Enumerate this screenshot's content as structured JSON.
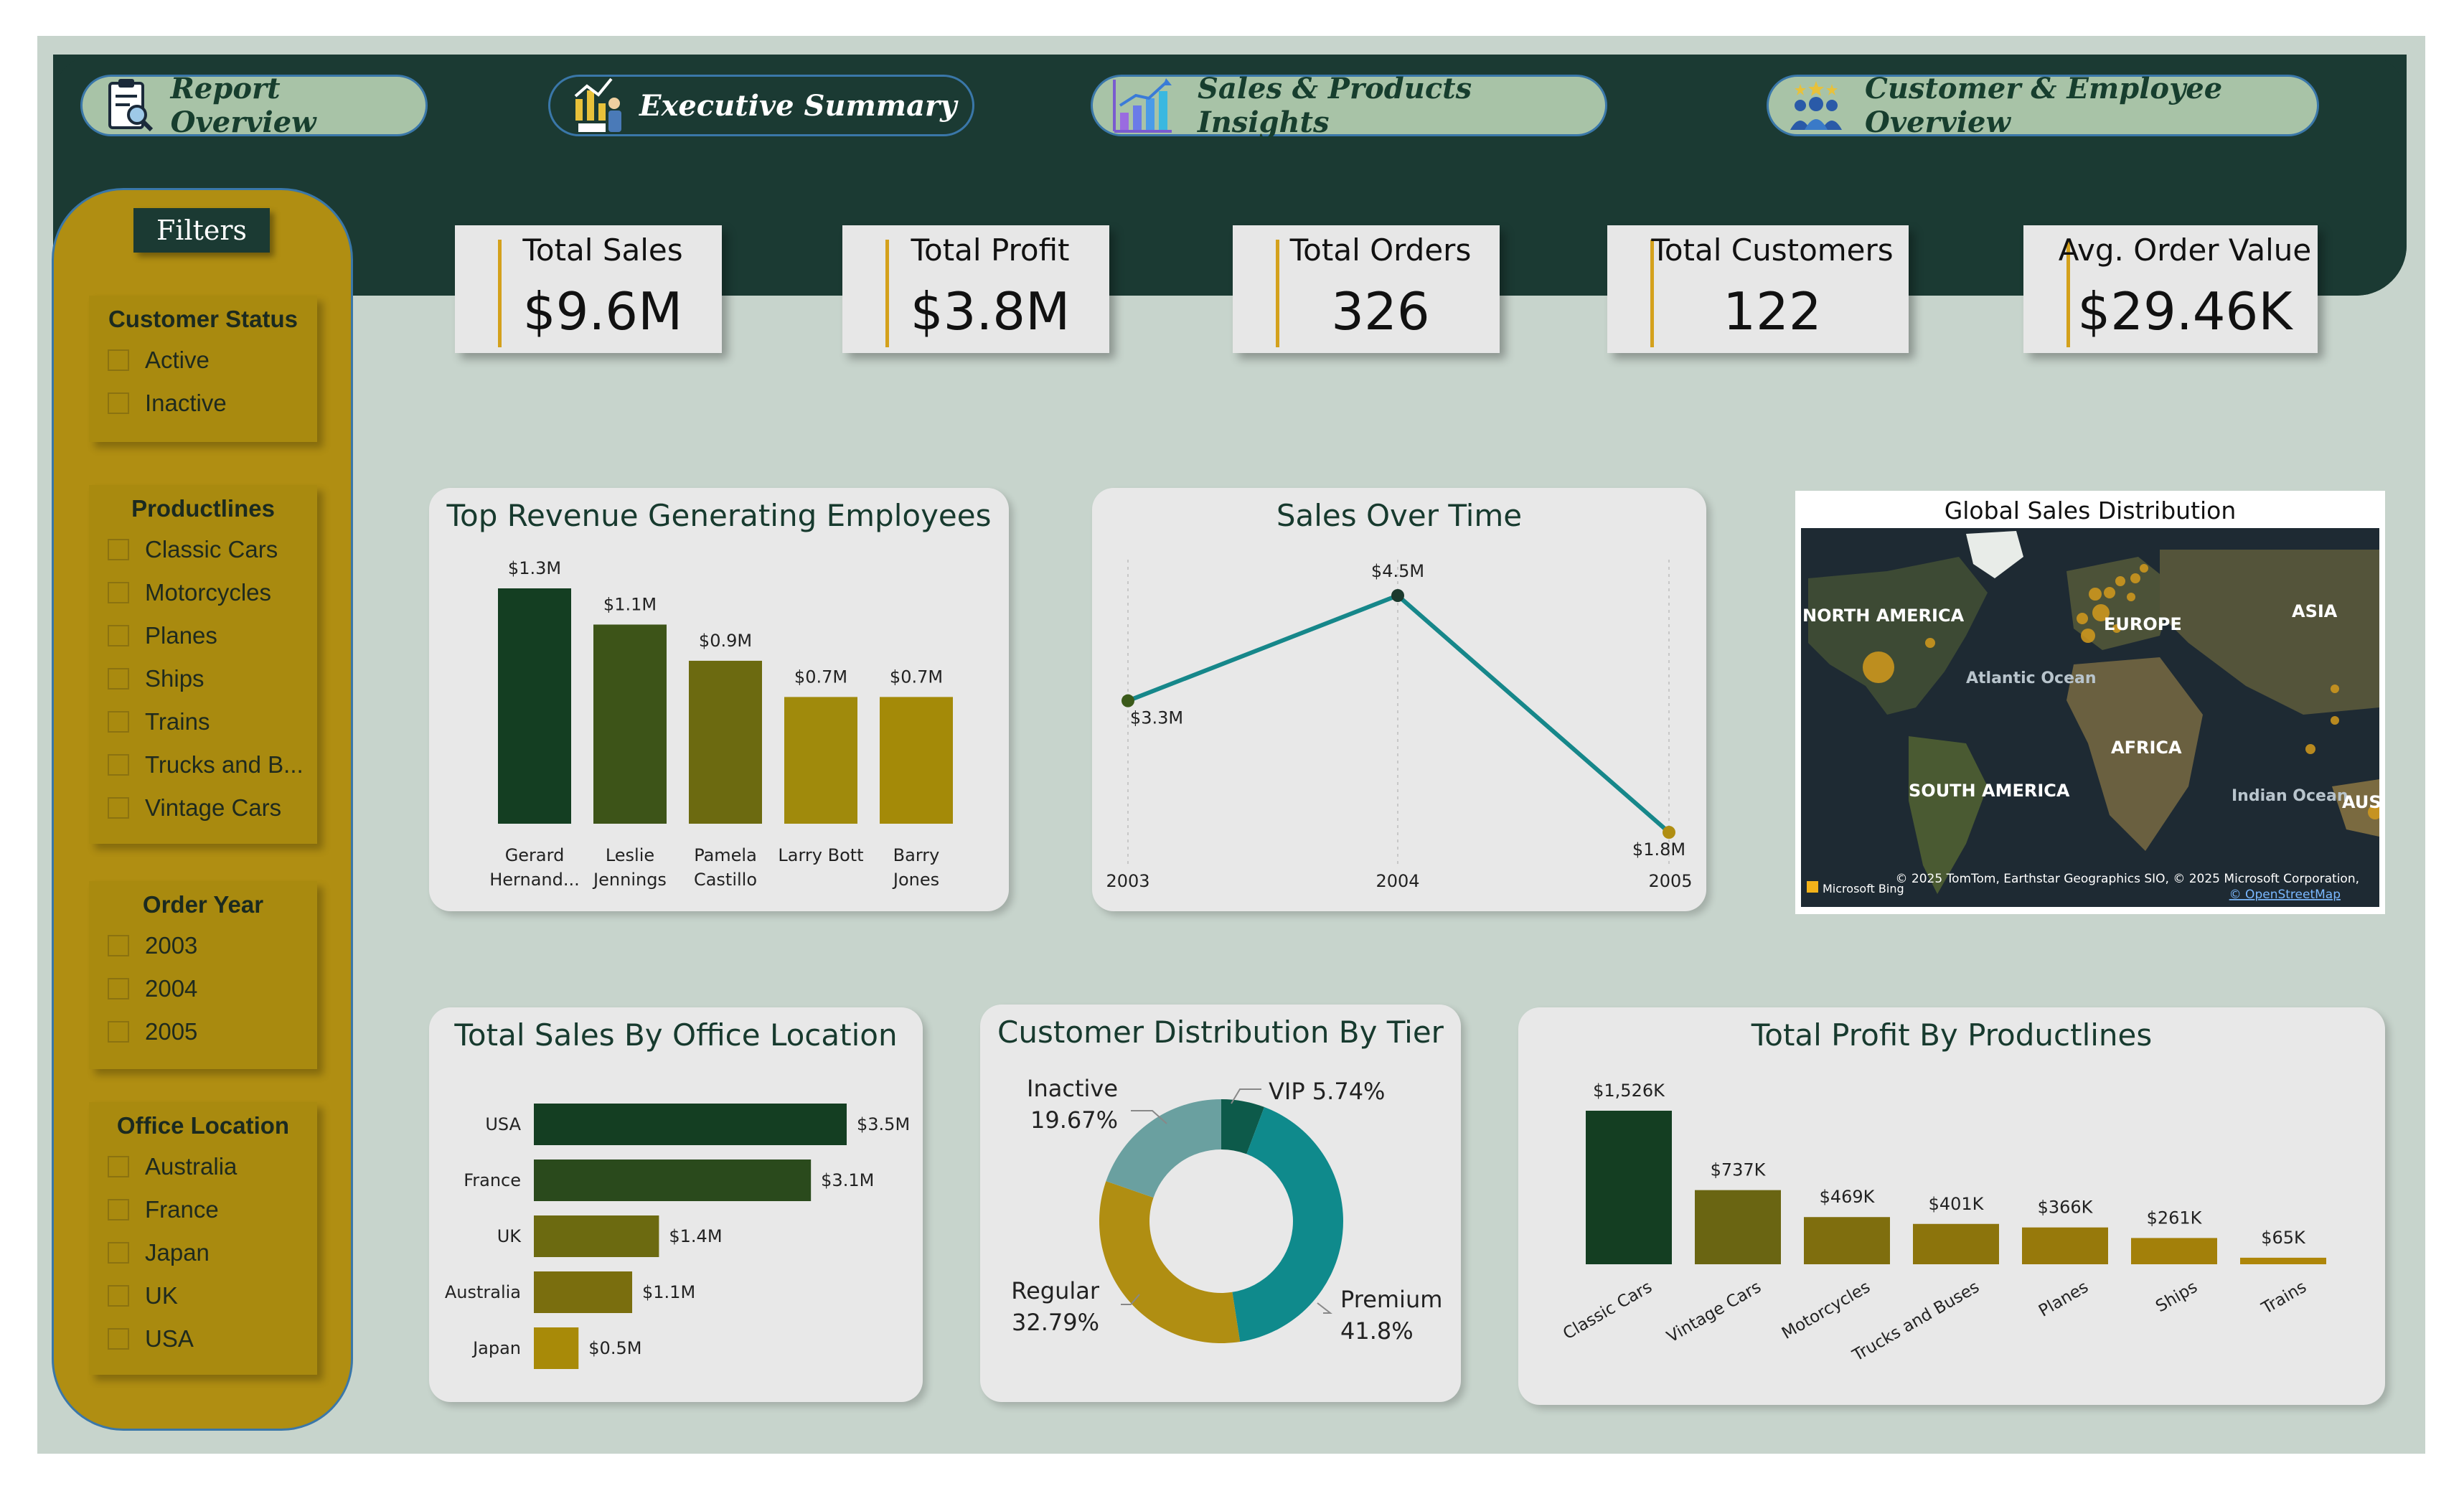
{
  "nav": [
    {
      "label": "Report Overview",
      "icon": "clipboard-search-icon"
    },
    {
      "label": "Executive Summary",
      "icon": "presentation-chart-icon"
    },
    {
      "label": "Sales & Products Insights",
      "icon": "bar-chart-icon"
    },
    {
      "label": "Customer & Employee Overview",
      "icon": "people-group-icon"
    }
  ],
  "filters": {
    "title": "Filters",
    "customer_status": {
      "title": "Customer Status",
      "options": [
        "Active",
        "Inactive"
      ]
    },
    "productlines": {
      "title": "Productlines",
      "options": [
        "Classic Cars",
        "Motorcycles",
        "Planes",
        "Ships",
        "Trains",
        "Trucks and B...",
        "Vintage Cars"
      ]
    },
    "order_year": {
      "title": "Order Year",
      "options": [
        "2003",
        "2004",
        "2005"
      ]
    },
    "office_location": {
      "title": "Office Location",
      "options": [
        "Australia",
        "France",
        "Japan",
        "UK",
        "USA"
      ]
    }
  },
  "kpis": [
    {
      "label": "Total Sales",
      "value": "$9.6M"
    },
    {
      "label": "Total Profit",
      "value": "$3.8M"
    },
    {
      "label": "Total Orders",
      "value": "326"
    },
    {
      "label": "Total Customers",
      "value": "122"
    },
    {
      "label": "Avg. Order Value",
      "value": "$29.46K"
    }
  ],
  "colors": {
    "dark_green": "#1b3a33",
    "gold": "#b08e12",
    "teal": "#0f8a8c",
    "background": "#c7d4cc"
  },
  "map": {
    "title": "Global Sales Distribution",
    "labels": [
      "NORTH AMERICA",
      "EUROPE",
      "ASIA",
      "Atlantic Ocean",
      "AFRICA",
      "SOUTH AMERICA",
      "Indian Ocean",
      "AUS"
    ],
    "attribution": "© 2025 TomTom, Earthstar Geographics SIO, © 2025 Microsoft Corporation,",
    "osm": "© OpenStreetMap",
    "bing": "Microsoft Bing"
  },
  "chart_data": [
    {
      "type": "bar",
      "title": "Top Revenue Generating Employees",
      "categories": [
        [
          "Gerard",
          "Hernand..."
        ],
        [
          "Leslie",
          "Jennings"
        ],
        [
          "Pamela",
          "Castillo"
        ],
        [
          "Larry Bott"
        ],
        [
          "Barry",
          "Jones"
        ]
      ],
      "values": [
        1.3,
        1.1,
        0.9,
        0.7,
        0.7
      ],
      "data_labels": [
        "$1.3M",
        "$1.1M",
        "$0.9M",
        "$0.7M",
        "$0.7M"
      ],
      "colors": [
        "#143e22",
        "#3d5418",
        "#6c6a10",
        "#a08a0c",
        "#a48a08"
      ]
    },
    {
      "type": "line",
      "title": "Sales Over Time",
      "x": [
        "2003",
        "2004",
        "2005"
      ],
      "values": [
        3.3,
        4.5,
        1.8
      ],
      "data_labels": [
        "$3.3M",
        "$4.5M",
        "$1.8M"
      ],
      "color": "#16878a"
    },
    {
      "type": "bar",
      "orientation": "horizontal",
      "title": "Total Sales By Office Location",
      "categories": [
        "USA",
        "France",
        "UK",
        "Australia",
        "Japan"
      ],
      "values": [
        3.5,
        3.1,
        1.4,
        1.1,
        0.5
      ],
      "data_labels": [
        "$3.5M",
        "$3.1M",
        "$1.4M",
        "$1.1M",
        "$0.5M"
      ],
      "colors": [
        "#143e22",
        "#2a4a1c",
        "#6c6a10",
        "#7a6e0e",
        "#a88a08"
      ]
    },
    {
      "type": "pie",
      "donut": true,
      "title": "Customer Distribution By Tier",
      "categories": [
        "VIP",
        "Premium",
        "Regular",
        "Inactive"
      ],
      "values": [
        5.74,
        41.8,
        32.79,
        19.67
      ],
      "labels": [
        [
          "VIP 5.74%"
        ],
        [
          "Premium",
          "41.8%"
        ],
        [
          "Regular",
          "32.79%"
        ],
        [
          "Inactive",
          "19.67%"
        ]
      ],
      "colors": [
        "#0d5a4a",
        "#0f8a8c",
        "#b08e12",
        "#6aa0a0"
      ]
    },
    {
      "type": "bar",
      "title": "Total Profit By Productlines",
      "categories": [
        "Classic Cars",
        "Vintage Cars",
        "Motorcycles",
        "Trucks and Buses",
        "Planes",
        "Ships",
        "Trains"
      ],
      "values": [
        1526,
        737,
        469,
        401,
        366,
        261,
        65
      ],
      "data_labels": [
        "$1,526K",
        "$737K",
        "$469K",
        "$401K",
        "$366K",
        "$261K",
        "$65K"
      ],
      "colors": [
        "#143e22",
        "#6a6512",
        "#7f6e0e",
        "#8c740c",
        "#97790b",
        "#a3800a",
        "#ae8609"
      ]
    }
  ]
}
